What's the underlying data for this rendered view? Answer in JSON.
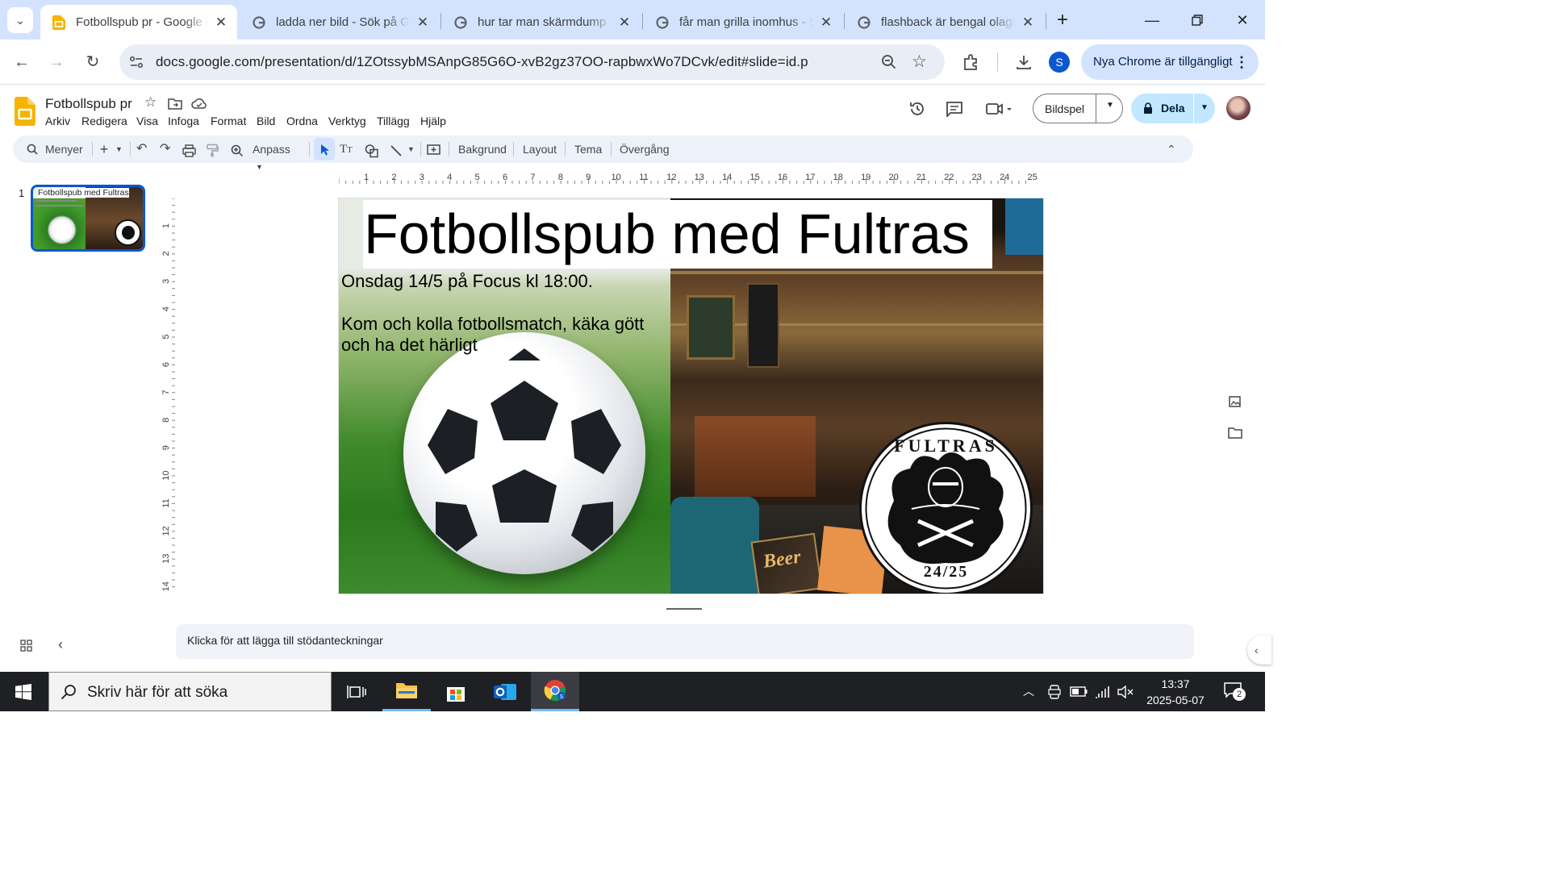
{
  "browser": {
    "tabs": [
      {
        "title": "Fotbollspub pr - Google Presentationer",
        "active": true
      },
      {
        "title": "ladda ner bild - Sök på Google",
        "active": false
      },
      {
        "title": "hur tar man skärmdump - Sök på Google",
        "active": false
      },
      {
        "title": "får man grilla inomhus - Sök på Google",
        "active": false
      },
      {
        "title": "flashback är bengal olagligt - Sök på Google",
        "active": false
      }
    ],
    "url": "docs.google.com/presentation/d/1ZOtssybMSAnpG85G6O-xvB2gz37OO-rapbwxWo7DCvk/edit#slide=id.p",
    "profile_initial": "S",
    "update_label": "Nya Chrome är tillgängligt",
    "new_tab": "+",
    "close": "✕"
  },
  "app": {
    "title": "Fotbollspub pr",
    "menus": [
      "Arkiv",
      "Redigera",
      "Visa",
      "Infoga",
      "Format",
      "Bild",
      "Ordna",
      "Verktyg",
      "Tillägg",
      "Hjälp"
    ],
    "slideshow_label": "Bildspel",
    "share_label": "Dela",
    "toolbar": {
      "search_menus": "Menyer",
      "zoom_label": "Anpass",
      "background": "Bakgrund",
      "layout": "Layout",
      "theme": "Tema",
      "transition": "Övergång"
    },
    "ruler_h": [
      "1",
      "2",
      "3",
      "4",
      "5",
      "6",
      "7",
      "8",
      "9",
      "10",
      "11",
      "12",
      "13",
      "14",
      "15",
      "16",
      "17",
      "18",
      "19",
      "20",
      "21",
      "22",
      "23",
      "24",
      "25"
    ],
    "ruler_v": [
      "1",
      "2",
      "3",
      "4",
      "5",
      "6",
      "7",
      "8",
      "9",
      "10",
      "11",
      "12",
      "13",
      "14"
    ]
  },
  "filmstrip": {
    "slide_number": "1",
    "thumb_title": "Fotbollspub med Fultras"
  },
  "slide": {
    "title": "Fotbollspub med Fultras",
    "line1": "Onsdag 14/5 på Focus kl 18:00.",
    "line2": "Kom och kolla fotbollsmatch, käka gött och ha det härligt",
    "logo_top": "FULTRAS",
    "logo_bottom": "24/25",
    "beer_sign": "Beer"
  },
  "notes_placeholder": "Klicka för att lägga till stödanteckningar",
  "taskbar": {
    "search_placeholder": "Skriv här för att söka",
    "time": "13:37",
    "date": "2025-05-07",
    "notification_count": "2"
  },
  "colors": {
    "tabstrip": "#d3e3fd",
    "accent": "#0b57d0",
    "share": "#c2e7ff",
    "slides_yellow": "#f4b400"
  }
}
